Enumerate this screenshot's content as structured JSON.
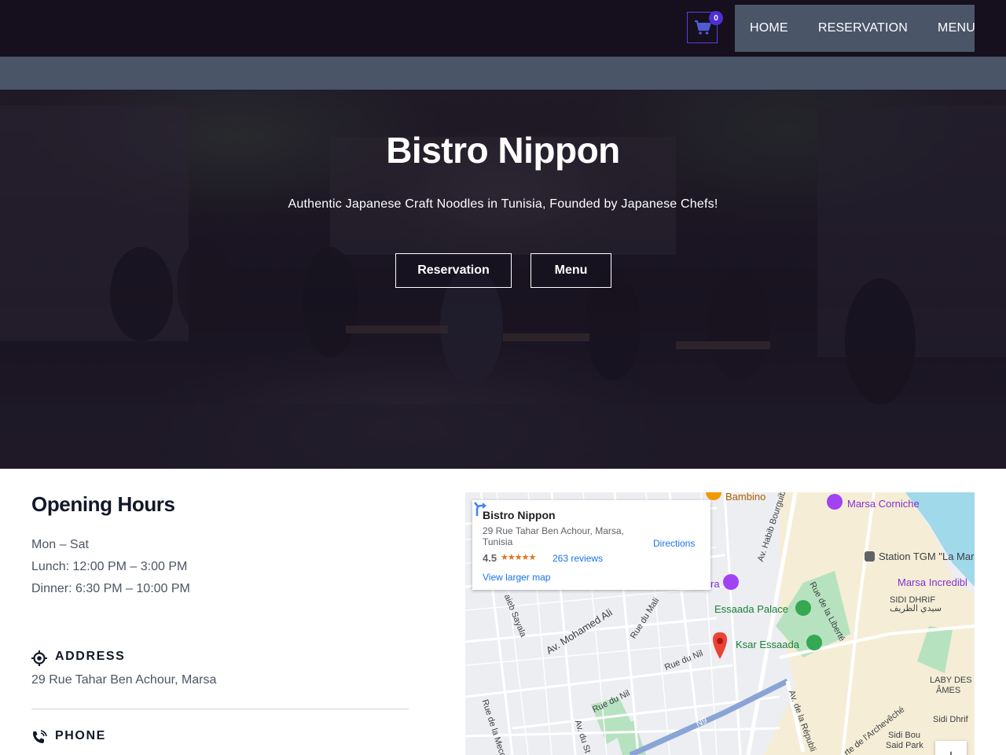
{
  "nav": {
    "cart_count": "0",
    "links": [
      "HOME",
      "RESERVATION",
      "MENU"
    ]
  },
  "hero": {
    "title": "Bistro Nippon",
    "subtitle": "Authentic Japanese Craft Noodles in Tunisia, Founded by Japanese Chefs!",
    "buttons": [
      "Reservation",
      "Menu"
    ]
  },
  "hours": {
    "title": "Opening Hours",
    "days": "Mon – Sat",
    "lunch": "Lunch: 12:00 PM – 3:00 PM",
    "dinner": "Dinner: 6:30 PM – 10:00 PM"
  },
  "address": {
    "label": "ADDRESS",
    "value": "29 Rue Tahar Ben Achour, Marsa",
    "icon": "location-target-icon"
  },
  "phone": {
    "label": "PHONE",
    "icon": "phone-ringing-icon"
  },
  "map": {
    "card": {
      "name": "Bistro Nippon",
      "address": "29 Rue Tahar Ben Achour, Marsa, Tunisia",
      "rating": "4.5",
      "stars": "★★★★★",
      "reviews": "263 reviews",
      "directions": "Directions",
      "larger_map": "View larger map"
    },
    "labels": {
      "bambino": "Bambino",
      "marsa_corniche": "Marsa Corniche",
      "habib_bourguiba": "Av. Habib Bourguiba",
      "station_tgm": "Station TGM \"La Mars",
      "marsa_incredible": "Marsa Incredibl",
      "sidi_dhrif": "SIDI DHRIF",
      "sidi_dhrif_ar": "سيدي الظريف",
      "essaada_palace": "Essaada Palace",
      "ksar_essaada": "Ksar Essaada",
      "rue_liberte": "Rue de la Liberté",
      "mohamed_ali": "Av. Mohamed Ali",
      "rue_mali": "Rue du Mali",
      "rue_nil": "Rue du Nil",
      "rue_nil_2": "Rue du Nil",
      "aieb_sayala": "aieb Sayala",
      "rue_mecque": "Rue de la Mecqu",
      "av_du_st": "Av. du St",
      "n9": "N9",
      "av_republique": "Av. de la Républi",
      "archeveche": "rte de l'Archevêché",
      "laby_des": "LABY DES",
      "ames": "ÂMES",
      "sidi_dhrif_2": "Sidi Dhrif",
      "sidi_bou": "Sidi Bou",
      "said_park": "Said Park",
      "ra": "ra",
      "zoom_in": "+"
    },
    "colors": {
      "water": "#9fd9ea",
      "park": "#b7e2c0",
      "sand": "#f7ecd0",
      "road": "#ffffff",
      "highway": "#8aa4d6",
      "pin": "#ea4335"
    }
  }
}
